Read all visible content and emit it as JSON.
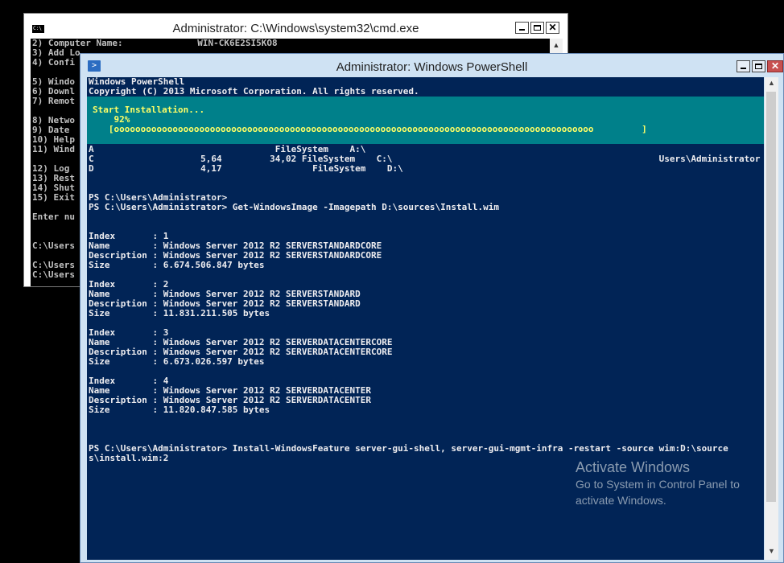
{
  "cmd_window": {
    "title": "Administrator: C:\\Windows\\system32\\cmd.exe",
    "icon_text": "C:\\",
    "lines": [
      "2) Computer Name:              WIN-CK6E2SI5KO8",
      "3) Add Lo",
      "4) Confi",
      "",
      "5) Windo",
      "6) Downl",
      "7) Remot",
      "",
      "8) Netwo",
      "9) Date",
      "10) Help",
      "11) Wind",
      "",
      "12) Log",
      "13) Rest",
      "14) Shut",
      "15) Exit",
      "",
      "Enter nu",
      "",
      "",
      "C:\\Users",
      "",
      "C:\\Users",
      "C:\\Users"
    ]
  },
  "ps_window": {
    "title": "Administrator: Windows PowerShell",
    "top_lines": [
      "Windows PowerShell",
      "Copyright (C) 2013 Microsoft Corporation. All rights reserved."
    ],
    "progress": {
      "label": "Start Installation...",
      "percent_text": "92%",
      "percent": 92,
      "bar_text": "[oooooooooooooooooooooooooooooooooooooooooooooooooooooooooooooooooooooooooooooooooooooooooo         ]"
    },
    "lines": [
      "A                                  FileSystem    A:\\",
      "C                    5,64         34,02 FileSystem    C:\\                                                  Users\\Administrator",
      "D                    4,17                 FileSystem    D:\\",
      "",
      "",
      "PS C:\\Users\\Administrator>",
      "PS C:\\Users\\Administrator> Get-WindowsImage -Imagepath D:\\sources\\Install.wim",
      "",
      "",
      "Index       : 1",
      "Name        : Windows Server 2012 R2 SERVERSTANDARDCORE",
      "Description : Windows Server 2012 R2 SERVERSTANDARDCORE",
      "Size        : 6.674.506.847 bytes",
      "",
      "Index       : 2",
      "Name        : Windows Server 2012 R2 SERVERSTANDARD",
      "Description : Windows Server 2012 R2 SERVERSTANDARD",
      "Size        : 11.831.211.505 bytes",
      "",
      "Index       : 3",
      "Name        : Windows Server 2012 R2 SERVERDATACENTERCORE",
      "Description : Windows Server 2012 R2 SERVERDATACENTERCORE",
      "Size        : 6.673.026.597 bytes",
      "",
      "Index       : 4",
      "Name        : Windows Server 2012 R2 SERVERDATACENTER",
      "Description : Windows Server 2012 R2 SERVERDATACENTER",
      "Size        : 11.820.847.585 bytes",
      "",
      "",
      "",
      "PS C:\\Users\\Administrator> Install-WindowsFeature server-gui-shell, server-gui-mgmt-infra -restart -source wim:D:\\source",
      "s\\install.wim:2"
    ]
  },
  "watermark": {
    "title": "Activate Windows",
    "line1": "Go to System in Control Panel to",
    "line2": "activate Windows."
  }
}
